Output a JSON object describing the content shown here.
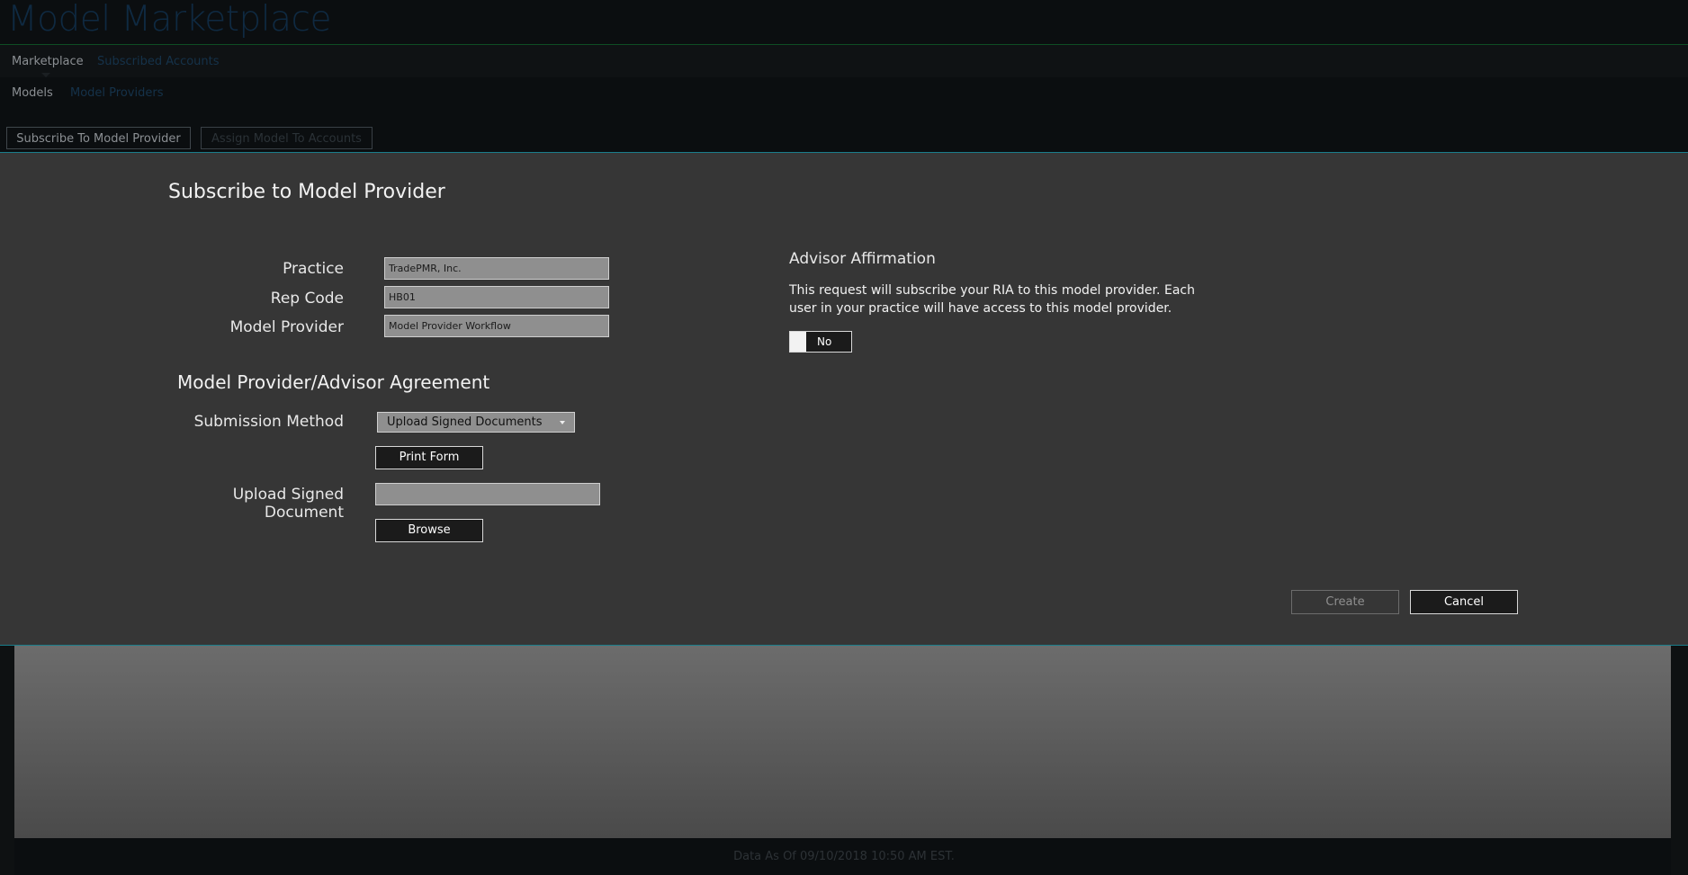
{
  "app": {
    "title": "Model Marketplace"
  },
  "nav": {
    "primary": [
      "Marketplace",
      "Subscribed Accounts"
    ],
    "secondary": [
      "Models",
      "Model Providers"
    ]
  },
  "toolbar": {
    "subscribe_label": "Subscribe To Model Provider",
    "assign_label": "Assign Model To Accounts"
  },
  "modal": {
    "title": "Subscribe to Model Provider",
    "fields": {
      "practice_label": "Practice",
      "practice_value": "TradePMR, Inc.",
      "rep_code_label": "Rep Code",
      "rep_code_value": "HB01",
      "model_provider_label": "Model Provider",
      "model_provider_value": "Model Provider Workflow"
    },
    "agreement": {
      "title": "Model Provider/Advisor Agreement",
      "submission_method_label": "Submission Method",
      "submission_method_value": "Upload Signed Documents",
      "print_form_label": "Print Form",
      "upload_label": "Upload Signed Document",
      "upload_value": "",
      "browse_label": "Browse"
    },
    "affirmation": {
      "title": "Advisor Affirmation",
      "text": "This request will subscribe your RIA to this model provider. Each user in your practice will have access to this model provider.",
      "toggle_label": "No"
    },
    "actions": {
      "create_label": "Create",
      "cancel_label": "Cancel"
    }
  },
  "footer": {
    "data_as_of": "Data As Of 09/10/2018 10:50 AM EST."
  },
  "colors": {
    "accent_line": "#1a7d8a",
    "modal_bg": "#363636",
    "field_bg": "#8f8f8f",
    "page_bg": "#0b0e10"
  }
}
